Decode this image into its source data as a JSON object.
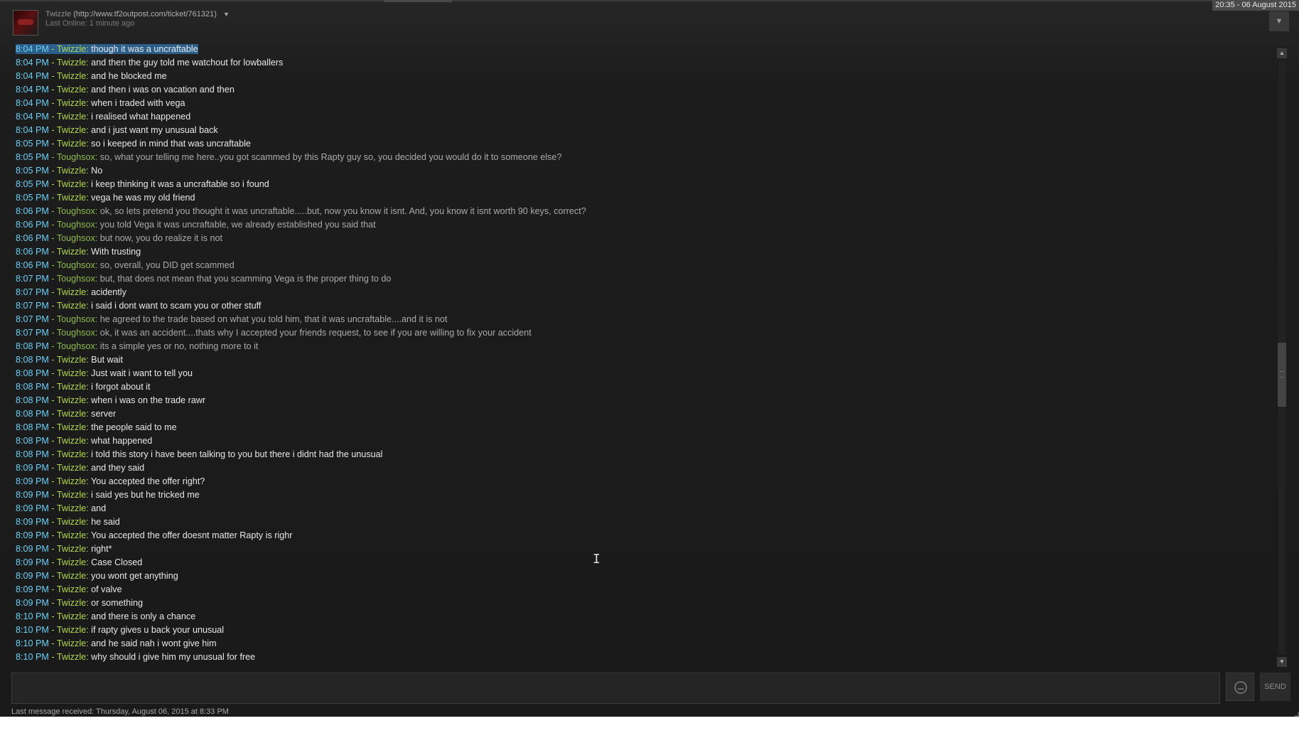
{
  "window": {
    "datetime": "20:35 - 06 August 2015"
  },
  "header": {
    "friend_name": "Twizzle",
    "friend_url": "(http://www.tf2outpost.com/ticket/761321)",
    "last_online": "Last Online: 1 minute ago"
  },
  "icons": {
    "collapse": "chevron-down-icon",
    "emoticon": "smiley-icon",
    "scroll_up": "arrow-up-icon",
    "scroll_down": "arrow-down-icon"
  },
  "colors": {
    "timestamp": "#6dcff6",
    "twizzle_name": "#b3d74f",
    "toughsox_name": "#8fba4e",
    "twizzle_text": "#e8e8e8",
    "toughsox_text": "#aaaaaa",
    "selection": "#2c5e8a"
  },
  "messages": [
    {
      "time": "8:04 PM",
      "user": "Twizzle",
      "text": "though it was a uncraftable",
      "selected": true
    },
    {
      "time": "8:04 PM",
      "user": "Twizzle",
      "text": "and then the guy told me watchout for lowballers"
    },
    {
      "time": "8:04 PM",
      "user": "Twizzle",
      "text": "and he blocked me"
    },
    {
      "time": "8:04 PM",
      "user": "Twizzle",
      "text": "and then i was on vacation and then"
    },
    {
      "time": "8:04 PM",
      "user": "Twizzle",
      "text": "when i traded with  vega"
    },
    {
      "time": "8:04 PM",
      "user": "Twizzle",
      "text": "i realised what happened"
    },
    {
      "time": "8:04 PM",
      "user": "Twizzle",
      "text": "and i just want my unusual back"
    },
    {
      "time": "8:05 PM",
      "user": "Twizzle",
      "text": "so i keeped in mind that was uncraftable"
    },
    {
      "time": "8:05 PM",
      "user": "Toughsox",
      "text": "so, what your telling me here..you got scammed by this Rapty guy so, you decided you would do it to someone else?"
    },
    {
      "time": "8:05 PM",
      "user": "Twizzle",
      "text": "No"
    },
    {
      "time": "8:05 PM",
      "user": "Twizzle",
      "text": "i keep thinking it was a uncraftable so i found"
    },
    {
      "time": "8:05 PM",
      "user": "Twizzle",
      "text": "vega he was my old friend"
    },
    {
      "time": "8:06 PM",
      "user": "Toughsox",
      "text": "ok, so lets pretend you thought it was uncraftable.....but, now you know it isnt. And, you know it isnt worth 90 keys, correct?"
    },
    {
      "time": "8:06 PM",
      "user": "Toughsox",
      "text": "you told Vega it was uncraftable, we already established you said that"
    },
    {
      "time": "8:06 PM",
      "user": "Toughsox",
      "text": "but now, you do realize it is not"
    },
    {
      "time": "8:06 PM",
      "user": "Twizzle",
      "text": "With trusting"
    },
    {
      "time": "8:06 PM",
      "user": "Toughsox",
      "text": "so, overall, you DID get scammed"
    },
    {
      "time": "8:07 PM",
      "user": "Toughsox",
      "text": "but, that does not mean that you scamming Vega is the proper thing to do"
    },
    {
      "time": "8:07 PM",
      "user": "Twizzle",
      "text": "acidently"
    },
    {
      "time": "8:07 PM",
      "user": "Twizzle",
      "text": "i said i dont want to scam you or other stuff"
    },
    {
      "time": "8:07 PM",
      "user": "Toughsox",
      "text": "he agreed to the trade based on what you told him, that it was uncraftable....and it is not"
    },
    {
      "time": "8:07 PM",
      "user": "Toughsox",
      "text": "ok, it was an accident....thats why I accepted your friends request, to see if you are willing to fix your accident"
    },
    {
      "time": "8:08 PM",
      "user": "Toughsox",
      "text": "its a simple yes or no, nothing more to it"
    },
    {
      "time": "8:08 PM",
      "user": "Twizzle",
      "text": "But wait"
    },
    {
      "time": "8:08 PM",
      "user": "Twizzle",
      "text": "Just wait i want to tell you"
    },
    {
      "time": "8:08 PM",
      "user": "Twizzle",
      "text": "i forgot about it"
    },
    {
      "time": "8:08 PM",
      "user": "Twizzle",
      "text": "when i was on the trade rawr"
    },
    {
      "time": "8:08 PM",
      "user": "Twizzle",
      "text": "server"
    },
    {
      "time": "8:08 PM",
      "user": "Twizzle",
      "text": "the people said to me"
    },
    {
      "time": "8:08 PM",
      "user": "Twizzle",
      "text": "what happened"
    },
    {
      "time": "8:08 PM",
      "user": "Twizzle",
      "text": "i told this story i have been talking to you but there i didnt had the unusual"
    },
    {
      "time": "8:09 PM",
      "user": "Twizzle",
      "text": "and they said"
    },
    {
      "time": "8:09 PM",
      "user": "Twizzle",
      "text": "You accepted the offer right?"
    },
    {
      "time": "8:09 PM",
      "user": "Twizzle",
      "text": "i said yes but he tricked me"
    },
    {
      "time": "8:09 PM",
      "user": "Twizzle",
      "text": "and"
    },
    {
      "time": "8:09 PM",
      "user": "Twizzle",
      "text": "he said"
    },
    {
      "time": "8:09 PM",
      "user": "Twizzle",
      "text": "You accepted the offer doesnt matter Rapty is righr"
    },
    {
      "time": "8:09 PM",
      "user": "Twizzle",
      "text": "right*"
    },
    {
      "time": "8:09 PM",
      "user": "Twizzle",
      "text": "Case Closed"
    },
    {
      "time": "8:09 PM",
      "user": "Twizzle",
      "text": "you wont get anything"
    },
    {
      "time": "8:09 PM",
      "user": "Twizzle",
      "text": "of valve"
    },
    {
      "time": "8:09 PM",
      "user": "Twizzle",
      "text": "or something"
    },
    {
      "time": "8:10 PM",
      "user": "Twizzle",
      "text": "and there is only a chance"
    },
    {
      "time": "8:10 PM",
      "user": "Twizzle",
      "text": "if rapty gives u back your unusual"
    },
    {
      "time": "8:10 PM",
      "user": "Twizzle",
      "text": "and he said nah i wont give him"
    },
    {
      "time": "8:10 PM",
      "user": "Twizzle",
      "text": "why should i give him my unusual for free"
    }
  ],
  "composer": {
    "value": "",
    "send_label": "SEND"
  },
  "footer": {
    "last_received": "Last message received: Thursday, August 06, 2015 at 8:33 PM"
  }
}
